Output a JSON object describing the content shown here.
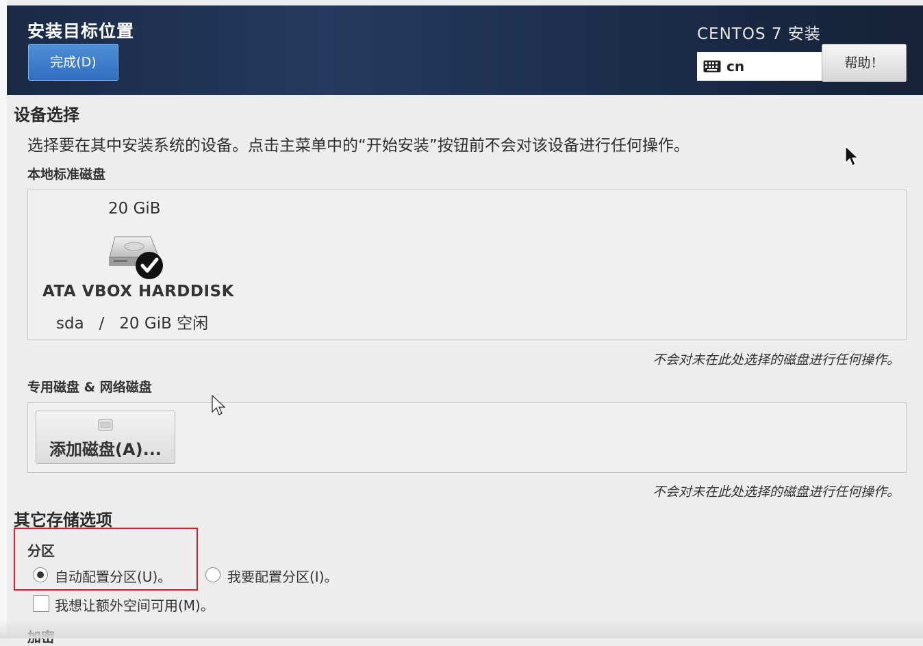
{
  "header": {
    "title": "安装目标位置",
    "done_label": "完成(D)",
    "product": "CENTOS 7 安装",
    "keyboard_layout": "cn",
    "help_label": "帮助！"
  },
  "device_selection": {
    "heading": "设备选择",
    "description": "选择要在其中安装系统的设备。点击主菜单中的“开始安装”按钮前不会对该设备进行任何操作。",
    "local_disks": {
      "heading": "本地标准磁盘",
      "disks": [
        {
          "size": "20 GiB",
          "name": "ATA VBOX HARDDISK",
          "info": "sda   /   20 GiB 空闲",
          "selected": true
        }
      ],
      "note": "不会对未在此处选择的磁盘进行任何操作。"
    },
    "special_disks": {
      "heading": "专用磁盘 & 网络磁盘",
      "add_label": "添加磁盘(A)...",
      "note": "不会对未在此处选择的磁盘进行任何操作。"
    }
  },
  "other_storage": {
    "heading": "其它存储选项",
    "partition": {
      "heading": "分区",
      "auto_label": "自动配置分区(U)。",
      "manual_label": "我要配置分区(I)。",
      "selected": "auto",
      "extra_space_label": "我想让额外空间可用(M)。",
      "extra_space_checked": false
    },
    "encryption_heading": "加密"
  },
  "colors": {
    "header_bg": "#1f3150",
    "done_button": "#3a7bc8",
    "highlight_box": "#d2232a"
  }
}
